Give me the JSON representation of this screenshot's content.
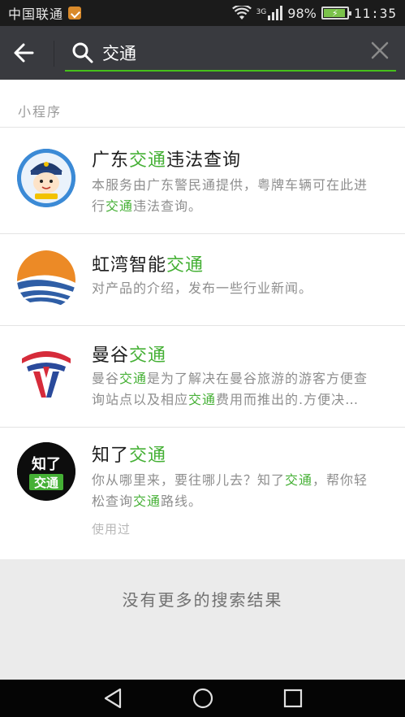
{
  "status_bar": {
    "carrier": "中国联通",
    "network": "3G",
    "battery": "98%",
    "battery_level": 0.98,
    "time": "11:35"
  },
  "search": {
    "query": "交通",
    "accent_color": "#45c01a"
  },
  "section": {
    "label": "小程序"
  },
  "results": [
    {
      "title": [
        {
          "t": "广东",
          "hl": false
        },
        {
          "t": "交通",
          "hl": true
        },
        {
          "t": "违法查询",
          "hl": false
        }
      ],
      "desc_lines": [
        [
          {
            "t": "本服务由广东警民通提供，粤牌车辆可在此进",
            "hl": false
          }
        ],
        [
          {
            "t": "行",
            "hl": false
          },
          {
            "t": "交通",
            "hl": true
          },
          {
            "t": "违法查询。",
            "hl": false
          }
        ]
      ],
      "icon": "police-cartoon-icon"
    },
    {
      "title": [
        {
          "t": "虹湾智能",
          "hl": false
        },
        {
          "t": "交通",
          "hl": true
        }
      ],
      "desc_lines": [
        [
          {
            "t": "对产品的介绍，发布一些行业新闻。",
            "hl": false
          }
        ]
      ],
      "icon": "wave-logo-icon"
    },
    {
      "title": [
        {
          "t": "曼谷",
          "hl": false
        },
        {
          "t": "交通",
          "hl": true
        }
      ],
      "desc_lines": [
        [
          {
            "t": "曼谷",
            "hl": false
          },
          {
            "t": "交通",
            "hl": true
          },
          {
            "t": "是为了解决在曼谷旅游的游客方便查",
            "hl": false
          }
        ],
        [
          {
            "t": "询站点以及相应",
            "hl": false
          },
          {
            "t": "交通",
            "hl": true
          },
          {
            "t": "费用而推出的.方便决…",
            "hl": false
          }
        ]
      ],
      "icon": "metro-logo-icon"
    },
    {
      "title": [
        {
          "t": "知了",
          "hl": false
        },
        {
          "t": "交通",
          "hl": true
        }
      ],
      "desc_lines": [
        [
          {
            "t": "你从哪里来，要往哪儿去？知了",
            "hl": false
          },
          {
            "t": "交通",
            "hl": true
          },
          {
            "t": "，帮你轻",
            "hl": false
          }
        ],
        [
          {
            "t": "松查询",
            "hl": false
          },
          {
            "t": "交通",
            "hl": true
          },
          {
            "t": "路线。",
            "hl": false
          }
        ]
      ],
      "used_label": "使用过",
      "icon": "zhiliao-logo-icon",
      "icon_text_top": "知了",
      "icon_text_bottom": "交通"
    }
  ],
  "footer": {
    "no_more": "没有更多的搜索结果"
  },
  "highlight_color": "#45b035"
}
